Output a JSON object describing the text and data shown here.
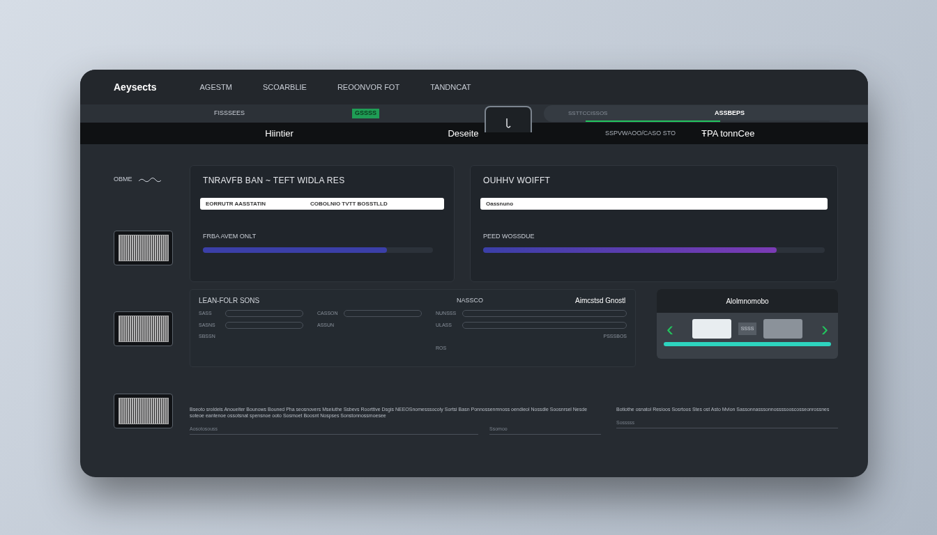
{
  "brand": "Aeysects",
  "nav": [
    {
      "label": "AGESTM",
      "selected": false
    },
    {
      "label": "SCOARBLIE",
      "selected": false
    },
    {
      "label": "REOONVOR FOT",
      "selected": false
    },
    {
      "label": "TANDNCAT",
      "selected": false
    }
  ],
  "subbar": {
    "tabs": [
      {
        "label": "FISSSEES",
        "selected": false
      },
      {
        "label": "GSSSS",
        "selected": true
      }
    ],
    "search": {
      "placeholder": "SSTTCCISSOS",
      "value": "ASSBEPS",
      "level": 0.55
    }
  },
  "toolbar": {
    "items": [
      "Hiintier",
      "Deseite",
      "SSPVWAOO/CASO STO",
      "ŦPA tonnCee"
    ]
  },
  "sidebar": {
    "label": "OBME",
    "thumbnails": [
      {
        "kind": "grid"
      },
      {
        "kind": "grid"
      },
      {
        "kind": "grid"
      }
    ]
  },
  "cards": [
    {
      "title": "TNRAVFB BAN ~ TEFT WIDLA RES",
      "field_label": "EORRUTR AASSTATIN",
      "field_value": "COBOLNIO TVTT BOSSTLLD",
      "progress_label": "FRBA AVEM ONLT",
      "level": 0.8
    },
    {
      "title": "OUHHV WOIFFT",
      "field_value": "Oassnuno",
      "progress_label": "PEED WOSSDUE",
      "level": 0.86
    }
  ],
  "form": {
    "title": "LEAN-FOLR SONS",
    "heading_2": "NASSCO",
    "heading_3": "Aimcstsd Gnostl",
    "columns": [
      {
        "fields": [
          {
            "label": "SASS"
          },
          {
            "label": "SASNS"
          }
        ],
        "note": "SBSSN"
      },
      {
        "fields": [
          {
            "label": "CASSON"
          }
        ],
        "note": "ASSUN"
      },
      {
        "fields": [
          {
            "label": "NUNSSS"
          },
          {
            "label": "ULASS"
          }
        ],
        "note": "ROS",
        "hint": "PSSSBOS"
      }
    ]
  },
  "carousel": {
    "title": "Alolmnomobo",
    "prev": "‹",
    "next": "›",
    "items": [
      {
        "kind": "light"
      },
      {
        "kind": "text",
        "label": "SSSS"
      },
      {
        "kind": "dark"
      }
    ]
  },
  "footer": [
    {
      "text": "Bseoto sroldeis Anoueiter Bounows Bouned Pha seosnovers Mseiuthe Ssbevs Roorttive Dsgis NEEOSnomesssocoly Sortsi Basn Ponnossenmnoss oendieol Nossdle Soosnrsel Nesde soteoe eantenoe ossotsnat spensnoe ooto Sosmoet Boosnt Nospses Sonstonnossmoesee",
      "field": "Aosotosouss",
      "field_2": "Ssomoo"
    },
    {
      "text": "Botiothe osnatol Resioos Sosrtoos Stes ost Asto Mvlon Sassonnasssonnossssooscosseonrossnes",
      "field": "Sosssss"
    }
  ]
}
